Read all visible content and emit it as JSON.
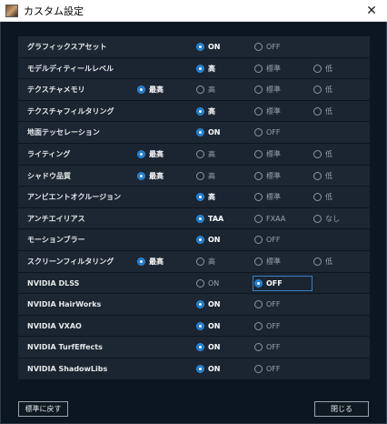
{
  "window": {
    "title": "カスタム設定",
    "close_glyph": "✕"
  },
  "rows": [
    {
      "label": "グラフィックスアセット",
      "options": [
        {
          "col": 1,
          "label": "ON",
          "selected": true
        },
        {
          "col": 2,
          "label": "OFF",
          "selected": false
        }
      ]
    },
    {
      "label": "モデルディティールレベル",
      "options": [
        {
          "col": 1,
          "label": "高",
          "selected": true
        },
        {
          "col": 2,
          "label": "標準",
          "selected": false
        },
        {
          "col": 3,
          "label": "低",
          "selected": false
        }
      ]
    },
    {
      "label": "テクスチャメモリ",
      "options": [
        {
          "col": 0,
          "label": "最高",
          "selected": true
        },
        {
          "col": 1,
          "label": "高",
          "selected": false
        },
        {
          "col": 2,
          "label": "標準",
          "selected": false
        },
        {
          "col": 3,
          "label": "低",
          "selected": false
        }
      ]
    },
    {
      "label": "テクスチャフィルタリング",
      "options": [
        {
          "col": 1,
          "label": "高",
          "selected": true
        },
        {
          "col": 2,
          "label": "標準",
          "selected": false
        },
        {
          "col": 3,
          "label": "低",
          "selected": false
        }
      ]
    },
    {
      "label": "地面テッセレーション",
      "options": [
        {
          "col": 1,
          "label": "ON",
          "selected": true
        },
        {
          "col": 2,
          "label": "OFF",
          "selected": false
        }
      ]
    },
    {
      "label": "ライティング",
      "options": [
        {
          "col": 0,
          "label": "最高",
          "selected": true
        },
        {
          "col": 1,
          "label": "高",
          "selected": false
        },
        {
          "col": 2,
          "label": "標準",
          "selected": false
        },
        {
          "col": 3,
          "label": "低",
          "selected": false
        }
      ]
    },
    {
      "label": "シャドウ品質",
      "options": [
        {
          "col": 0,
          "label": "最高",
          "selected": true
        },
        {
          "col": 1,
          "label": "高",
          "selected": false
        },
        {
          "col": 2,
          "label": "標準",
          "selected": false
        },
        {
          "col": 3,
          "label": "低",
          "selected": false
        }
      ]
    },
    {
      "label": "アンビエントオクルージョン",
      "options": [
        {
          "col": 1,
          "label": "高",
          "selected": true
        },
        {
          "col": 2,
          "label": "標準",
          "selected": false
        },
        {
          "col": 3,
          "label": "低",
          "selected": false
        }
      ]
    },
    {
      "label": "アンチエイリアス",
      "options": [
        {
          "col": 1,
          "label": "TAA",
          "selected": true
        },
        {
          "col": 2,
          "label": "FXAA",
          "selected": false
        },
        {
          "col": 3,
          "label": "なし",
          "selected": false
        }
      ]
    },
    {
      "label": "モーションブラー",
      "options": [
        {
          "col": 1,
          "label": "ON",
          "selected": true
        },
        {
          "col": 2,
          "label": "OFF",
          "selected": false
        }
      ]
    },
    {
      "label": "スクリーンフィルタリング",
      "options": [
        {
          "col": 0,
          "label": "最高",
          "selected": true
        },
        {
          "col": 1,
          "label": "高",
          "selected": false
        },
        {
          "col": 2,
          "label": "標準",
          "selected": false
        },
        {
          "col": 3,
          "label": "低",
          "selected": false
        }
      ]
    },
    {
      "label": "NVIDIA DLSS",
      "focused": true,
      "options": [
        {
          "col": 1,
          "label": "ON",
          "selected": false
        },
        {
          "col": 2,
          "label": "OFF",
          "selected": true
        }
      ]
    },
    {
      "label": "NVIDIA HairWorks",
      "options": [
        {
          "col": 1,
          "label": "ON",
          "selected": true
        },
        {
          "col": 2,
          "label": "OFF",
          "selected": false
        }
      ]
    },
    {
      "label": "NVIDIA VXAO",
      "options": [
        {
          "col": 1,
          "label": "ON",
          "selected": true
        },
        {
          "col": 2,
          "label": "OFF",
          "selected": false
        }
      ]
    },
    {
      "label": "NVIDIA TurfEffects",
      "options": [
        {
          "col": 1,
          "label": "ON",
          "selected": true
        },
        {
          "col": 2,
          "label": "OFF",
          "selected": false
        }
      ]
    },
    {
      "label": "NVIDIA ShadowLibs",
      "options": [
        {
          "col": 1,
          "label": "ON",
          "selected": true
        },
        {
          "col": 2,
          "label": "OFF",
          "selected": false
        }
      ]
    }
  ],
  "footer": {
    "reset_label": "標準に戻す",
    "close_label": "閉じる"
  },
  "colors": {
    "background": "#0c1620",
    "row": "#1b2531",
    "accent": "#1a7bd0"
  }
}
